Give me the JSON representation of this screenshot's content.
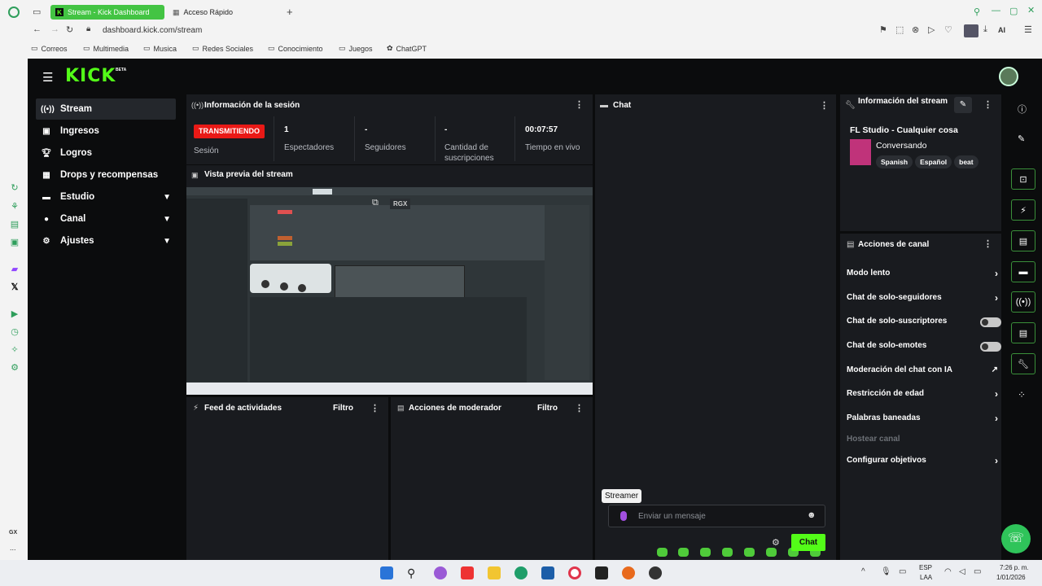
{
  "browser": {
    "tabs": [
      {
        "label": "Stream - Kick Dashboard",
        "active": true
      },
      {
        "label": "Acceso Rápido",
        "active": false
      }
    ],
    "new_tab": "+",
    "url": "dashboard.kick.com/stream",
    "ai_label": "AI",
    "bookmarks": [
      "Correos",
      "Multimedia",
      "Musica",
      "Redes Sociales",
      "Conocimiento",
      "Juegos",
      "ChatGPT"
    ]
  },
  "opera_sidebar": {
    "bottom_label": "GX",
    "more": "..."
  },
  "kick": {
    "logo": "KICK",
    "logo_badge": "BETA",
    "nav": [
      {
        "label": "Stream",
        "icon": "broadcast-icon",
        "active": true,
        "expandable": false
      },
      {
        "label": "Ingresos",
        "icon": "revenue-icon",
        "active": false,
        "expandable": false
      },
      {
        "label": "Logros",
        "icon": "trophy-icon",
        "active": false,
        "expandable": false
      },
      {
        "label": "Drops y recompensas",
        "icon": "gift-icon",
        "active": false,
        "expandable": false
      },
      {
        "label": "Estudio",
        "icon": "studio-icon",
        "active": false,
        "expandable": true
      },
      {
        "label": "Canal",
        "icon": "channel-icon",
        "active": false,
        "expandable": true
      },
      {
        "label": "Ajustes",
        "icon": "gear-icon",
        "active": false,
        "expandable": true
      }
    ],
    "session": {
      "title": "Información de la sesión",
      "status_badge": "TRANSMITIENDO",
      "status_label": "Sesión",
      "viewers_value": "1",
      "viewers_label": "Espectadores",
      "followers_value": "-",
      "followers_label": "Seguidores",
      "subs_value": "-",
      "subs_label": "Cantidad de suscripciones",
      "time_value": "00:07:57",
      "time_label": "Tiempo en vivo"
    },
    "preview": {
      "title": "Vista previa del stream",
      "overlay_text": "RGX"
    },
    "activity": {
      "title": "Feed de actividades",
      "filter": "Filtro"
    },
    "modactions": {
      "title": "Acciones de moderador",
      "filter": "Filtro"
    },
    "chat": {
      "title": "Chat",
      "tooltip": "Streamer",
      "placeholder": "Enviar un mensaje",
      "send_label": "Chat"
    },
    "stream_info": {
      "title": "Información del stream",
      "stream_title": "FL Studio - Cualquier cosa",
      "category": "Conversando",
      "tags": [
        "Spanish",
        "Español",
        "beat"
      ]
    },
    "channel_actions": {
      "title": "Acciones de canal",
      "items": [
        {
          "label": "Modo lento",
          "control": "chevron"
        },
        {
          "label": "Chat de solo-seguidores",
          "control": "chevron"
        },
        {
          "label": "Chat de solo-suscriptores",
          "control": "toggle"
        },
        {
          "label": "Chat de solo-emotes",
          "control": "toggle"
        },
        {
          "label": "Moderación del chat con IA",
          "control": "external"
        },
        {
          "label": "Restricción de edad",
          "control": "chevron"
        },
        {
          "label": "Palabras baneadas",
          "control": "chevron"
        },
        {
          "label": "Hostear canal",
          "control": "disabled"
        },
        {
          "label": "Configurar objetivos",
          "control": "chevron"
        }
      ]
    }
  },
  "taskbar": {
    "lang": "ESP",
    "lang_sub": "LAA",
    "time": "7:26 p. m.",
    "date": "1/01/2026"
  },
  "colors": {
    "kick_green": "#53fc18",
    "live_red": "#e91916",
    "bg": "#0b0c0d",
    "panel": "#191b1f"
  }
}
